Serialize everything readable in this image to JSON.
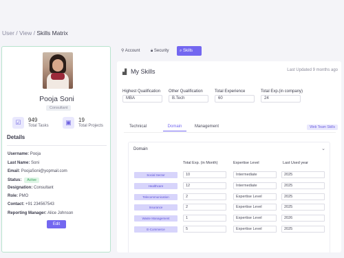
{
  "breadcrumb": {
    "path": "User / View / ",
    "current": "Skills Matrix"
  },
  "profile": {
    "name": "Pooja Soni",
    "role": "Consultant",
    "stats": [
      {
        "icon": "check-square-icon",
        "value": "949",
        "label": "Total Tasks"
      },
      {
        "icon": "briefcase-icon",
        "value": "19",
        "label": "Total Projects"
      }
    ],
    "details_title": "Details",
    "details": {
      "username_label": "Username:",
      "username": "Pooja",
      "lastname_label": "Last Name:",
      "lastname": "Soni",
      "email_label": "Email:",
      "email": "PoojaSoni@yopmail.com",
      "status_label": "Status:",
      "status": "Active",
      "designation_label": "Designation:",
      "designation": "Consultant",
      "role_label": "Role:",
      "role": "PMO",
      "contact_label": "Contact:",
      "contact": "+91 234567543",
      "manager_label": "Reporting Manager:",
      "manager": "Alice Johnson"
    },
    "edit_label": "Edit"
  },
  "top_tabs": [
    {
      "label": "Account",
      "icon": "user-icon"
    },
    {
      "label": "Security",
      "icon": "lock-icon"
    },
    {
      "label": "Skills",
      "icon": "search-icon"
    }
  ],
  "skills": {
    "title": "My Skills",
    "last_updated": "Last Updated 9 months ago",
    "qualifications": [
      {
        "label": "Highest Qualification",
        "value": "MBA"
      },
      {
        "label": "Other Qualification",
        "value": "B.Tech"
      },
      {
        "label": "Total Experience",
        "value": "60"
      },
      {
        "label": "Total Exp.(in company)",
        "value": "24"
      }
    ],
    "tabs": [
      "Technical",
      "Domain",
      "Management"
    ],
    "web_team_label": "Web Team Skills",
    "domain": {
      "title": "Domain",
      "headers": [
        "Total Exp. (in Month)",
        "Expertise Level",
        "Last Used year"
      ],
      "rows": [
        {
          "skill": "Social Sector",
          "exp": "10",
          "level": "Intermediate",
          "year": "2025"
        },
        {
          "skill": "Healthcare",
          "exp": "12",
          "level": "Intermediate",
          "year": "2025"
        },
        {
          "skill": "Telecommunication",
          "exp": "2",
          "level": "Expertise Level",
          "year": "2025"
        },
        {
          "skill": "Insurance",
          "exp": "2",
          "level": "Expertise Level",
          "year": "2025"
        },
        {
          "skill": "Waste Management",
          "exp": "1",
          "level": "Expertise Level",
          "year": "2026"
        },
        {
          "skill": "E-Commerce",
          "exp": "5",
          "level": "Expertise Level",
          "year": "2025"
        }
      ]
    }
  },
  "colors": {
    "accent": "#7367f0",
    "success": "#3aa25c",
    "card_border": "#b7e3cd"
  }
}
